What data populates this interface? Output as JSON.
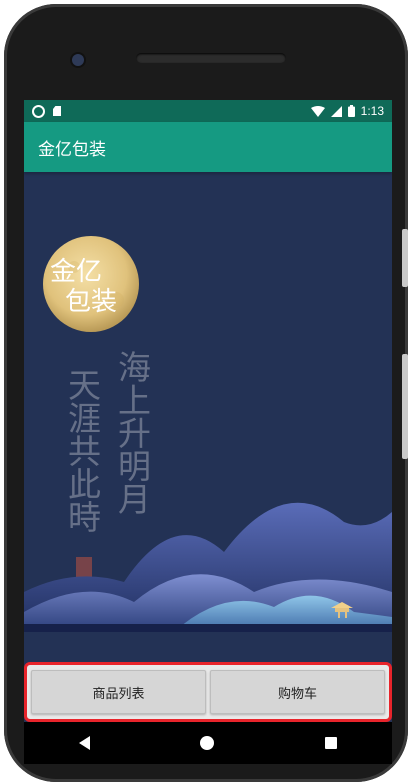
{
  "status_bar": {
    "time": "1:13",
    "icons": [
      "circle-icon",
      "sd-card-icon",
      "wifi-icon",
      "signal-icon",
      "battery-icon"
    ]
  },
  "app_bar": {
    "title": "金亿包装"
  },
  "banner": {
    "logo_line1": "金亿",
    "logo_line2": "包装",
    "poem_left": "天涯共此時",
    "poem_right": "海上升明月"
  },
  "buttons": {
    "product_list": "商品列表",
    "cart": "购物车"
  },
  "nav": {
    "icons": [
      "back-icon",
      "home-icon",
      "recent-apps-icon"
    ]
  },
  "colors": {
    "status_bar": "#0f6a58",
    "app_bar": "#159a82",
    "banner_bg": "#233255",
    "highlight_border": "#e8242b"
  }
}
